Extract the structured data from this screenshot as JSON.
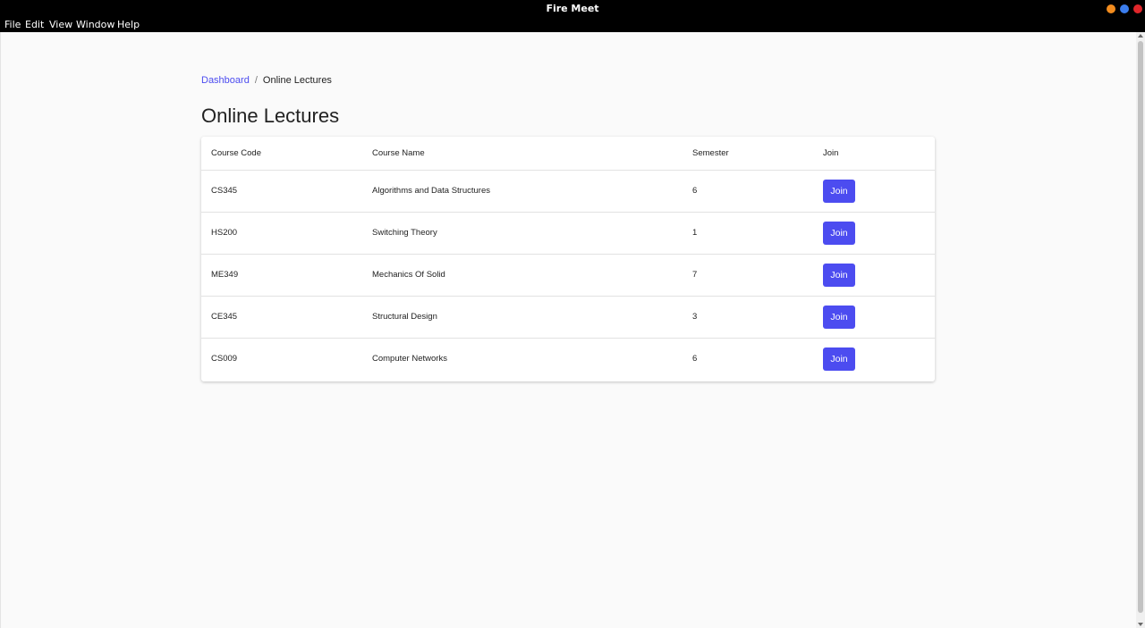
{
  "window": {
    "title": "Fire Meet",
    "controls": [
      "minimize-dot",
      "maximize-dot",
      "close-dot"
    ],
    "control_colors": {
      "minimize": "#f28c1e",
      "maximize": "#3b7ded",
      "close": "#e0262a"
    }
  },
  "menu": {
    "items": [
      "File",
      "Edit",
      "View",
      "Window",
      "Help"
    ]
  },
  "breadcrumb": {
    "link": "Dashboard",
    "separator": "/",
    "current": "Online Lectures"
  },
  "page": {
    "title": "Online Lectures"
  },
  "table": {
    "headers": [
      "Course Code",
      "Course Name",
      "Semester",
      "Join"
    ],
    "rows": [
      {
        "code": "CS345",
        "name": "Algorithms and Data Structures",
        "semester": "6",
        "join": "Join"
      },
      {
        "code": "HS200",
        "name": "Switching Theory",
        "semester": "1",
        "join": "Join"
      },
      {
        "code": "ME349",
        "name": "Mechanics Of Solid",
        "semester": "7",
        "join": "Join"
      },
      {
        "code": "CE345",
        "name": "Structural Design",
        "semester": "3",
        "join": "Join"
      },
      {
        "code": "CS009",
        "name": "Computer Networks",
        "semester": "6",
        "join": "Join"
      }
    ]
  },
  "colors": {
    "accent": "#4c4cf0",
    "background": "#fafafa",
    "titlebar": "#000000"
  }
}
